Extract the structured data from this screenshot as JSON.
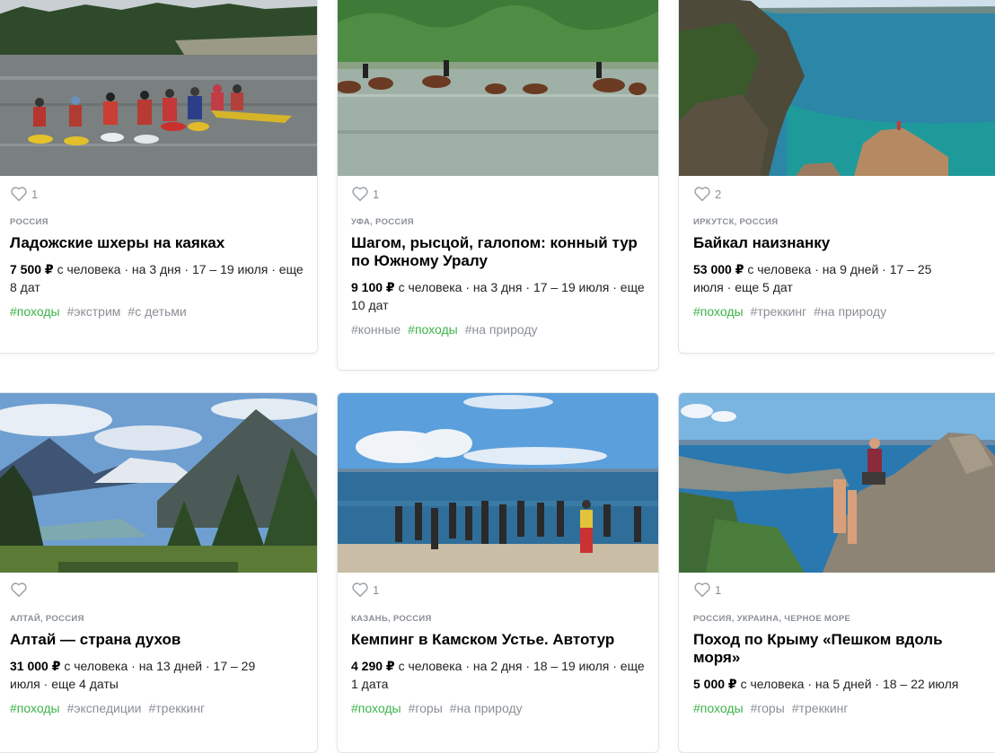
{
  "per_person": "с человека",
  "cards": [
    {
      "likes": "1",
      "location": "РОССИЯ",
      "title": "Ладожские шхеры на каяках",
      "price": "7 500 ₽",
      "days": "на 3 дня",
      "dates": "17 – 19 июля",
      "more": "еще 8 дат",
      "tags": [
        {
          "text": "#походы",
          "green": true
        },
        {
          "text": "#экстрим",
          "green": false
        },
        {
          "text": "#с детьми",
          "green": false
        }
      ]
    },
    {
      "likes": "1",
      "location": "УФА, РОССИЯ",
      "title": "Шагом, рысцой, галопом: конный тур по Южному Уралу",
      "price": "9 100 ₽",
      "days": "на 3 дня",
      "dates": "17 – 19 июля",
      "more": "еще 10 дат",
      "tags": [
        {
          "text": "#конные",
          "green": false
        },
        {
          "text": "#походы",
          "green": true
        },
        {
          "text": "#на природу",
          "green": false
        }
      ]
    },
    {
      "likes": "2",
      "location": "ИРКУТСК, РОССИЯ",
      "title": "Байкал наизнанку",
      "price": "53 000 ₽",
      "days": "на 9 дней",
      "dates": "17 – 25 июля",
      "more": "еще 5 дат",
      "tags": [
        {
          "text": "#походы",
          "green": true
        },
        {
          "text": "#треккинг",
          "green": false
        },
        {
          "text": "#на природу",
          "green": false
        }
      ]
    },
    {
      "likes": "",
      "location": "АЛТАЙ, РОССИЯ",
      "title": "Алтай — страна духов",
      "price": "31 000 ₽",
      "days": "на 13 дней",
      "dates": "17 – 29 июля",
      "more": "еще 4 даты",
      "tags": [
        {
          "text": "#походы",
          "green": true
        },
        {
          "text": "#экспедиции",
          "green": false
        },
        {
          "text": "#треккинг",
          "green": false
        }
      ]
    },
    {
      "likes": "1",
      "location": "КАЗАНЬ, РОССИЯ",
      "title": "Кемпинг в Камском Устье. Автотур",
      "price": "4 290 ₽",
      "days": "на 2 дня",
      "dates": "18 – 19 июля",
      "more": "еще 1 дата",
      "tags": [
        {
          "text": "#походы",
          "green": true
        },
        {
          "text": "#горы",
          "green": false
        },
        {
          "text": "#на природу",
          "green": false
        }
      ]
    },
    {
      "likes": "1",
      "location": "РОССИЯ, УКРАИНА, ЧЕРНОЕ МОРЕ",
      "title": "Поход по Крыму «Пешком вдоль моря»",
      "price": "5 000 ₽",
      "days": "на 5 дней",
      "dates": "18 – 22 июля",
      "more": "",
      "tags": [
        {
          "text": "#походы",
          "green": true
        },
        {
          "text": "#горы",
          "green": false
        },
        {
          "text": "#треккинг",
          "green": false
        }
      ]
    }
  ]
}
